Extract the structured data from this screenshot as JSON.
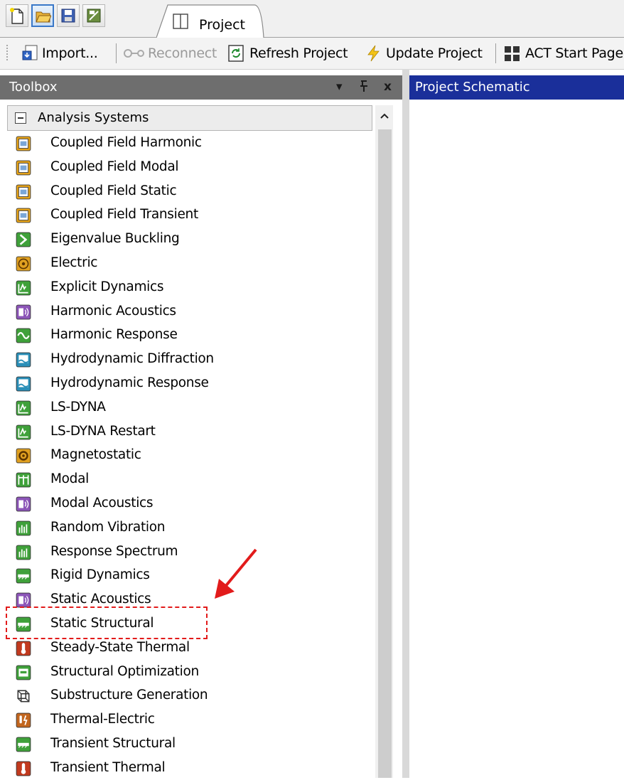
{
  "tab": {
    "label": "Project"
  },
  "toolbar": {
    "import_label": "Import...",
    "reconnect_label": "Reconnect",
    "refresh_label": "Refresh Project",
    "update_label": "Update Project",
    "act_label": "ACT Start Page"
  },
  "toolbox": {
    "title": "Toolbox",
    "controls": {
      "dropdown": "▾",
      "pin": "ᵖ",
      "close": "x"
    },
    "group": {
      "label": "Analysis Systems"
    },
    "items": [
      {
        "label": "Coupled Field Harmonic",
        "icon": "coupled-field-icon",
        "color": "#e8a418"
      },
      {
        "label": "Coupled Field Modal",
        "icon": "coupled-field-icon",
        "color": "#e8a418"
      },
      {
        "label": "Coupled Field Static",
        "icon": "coupled-field-icon",
        "color": "#e8a418"
      },
      {
        "label": "Coupled Field Transient",
        "icon": "coupled-field-icon",
        "color": "#e8a418"
      },
      {
        "label": "Eigenvalue Buckling",
        "icon": "eigenvalue-icon",
        "color": "#3fa13a"
      },
      {
        "label": "Electric",
        "icon": "electric-icon",
        "color": "#e0a020"
      },
      {
        "label": "Explicit Dynamics",
        "icon": "explicit-icon",
        "color": "#3fa13a"
      },
      {
        "label": "Harmonic Acoustics",
        "icon": "acoustics-icon",
        "color": "#8c55b8"
      },
      {
        "label": "Harmonic Response",
        "icon": "harmonic-icon",
        "color": "#3fa13a"
      },
      {
        "label": "Hydrodynamic Diffraction",
        "icon": "hydro-icon",
        "color": "#2a8fb8"
      },
      {
        "label": "Hydrodynamic Response",
        "icon": "hydro-icon",
        "color": "#2a8fb8"
      },
      {
        "label": "LS-DYNA",
        "icon": "explicit-icon",
        "color": "#3fa13a"
      },
      {
        "label": "LS-DYNA Restart",
        "icon": "explicit-icon",
        "color": "#3fa13a"
      },
      {
        "label": "Magnetostatic",
        "icon": "magnet-icon",
        "color": "#e0a020"
      },
      {
        "label": "Modal",
        "icon": "modal-icon",
        "color": "#3fa13a"
      },
      {
        "label": "Modal Acoustics",
        "icon": "acoustics-icon",
        "color": "#8c55b8"
      },
      {
        "label": "Random Vibration",
        "icon": "spectrum-icon",
        "color": "#3fa13a"
      },
      {
        "label": "Response Spectrum",
        "icon": "spectrum-icon",
        "color": "#3fa13a"
      },
      {
        "label": "Rigid Dynamics",
        "icon": "structural-icon",
        "color": "#3fa13a"
      },
      {
        "label": "Static Acoustics",
        "icon": "acoustics-icon",
        "color": "#8c55b8"
      },
      {
        "label": "Static Structural",
        "icon": "structural-icon",
        "color": "#3fa13a"
      },
      {
        "label": "Steady-State Thermal",
        "icon": "thermal-icon",
        "color": "#c23a1e"
      },
      {
        "label": "Structural Optimization",
        "icon": "optimization-icon",
        "color": "#3fa13a"
      },
      {
        "label": "Substructure Generation",
        "icon": "substructure-icon",
        "color": "#555555"
      },
      {
        "label": "Thermal-Electric",
        "icon": "thermal-electric-icon",
        "color": "#c2661e"
      },
      {
        "label": "Transient Structural",
        "icon": "structural-icon",
        "color": "#3fa13a"
      },
      {
        "label": "Transient Thermal",
        "icon": "thermal-icon",
        "color": "#c23a1e"
      }
    ]
  },
  "schematic": {
    "title": "Project Schematic"
  },
  "annotation": {
    "highlight_color": "#e21b1b"
  }
}
